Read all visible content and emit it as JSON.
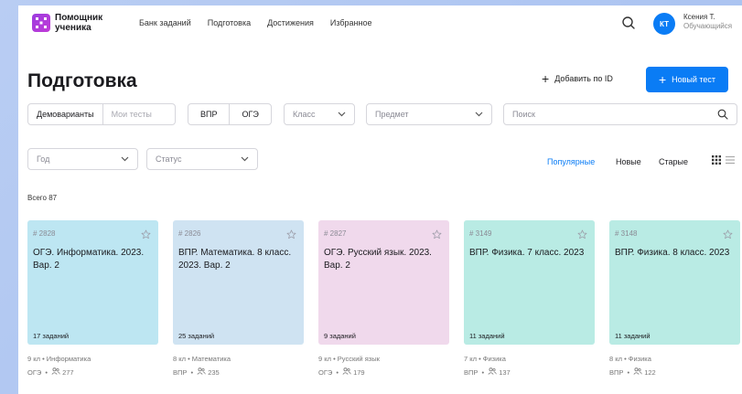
{
  "header": {
    "logo_line1": "Помощник",
    "logo_line2": "ученика",
    "nav": [
      "Банк заданий",
      "Подготовка",
      "Достижения",
      "Избранное"
    ],
    "avatar_initials": "КТ",
    "user_name": "Ксения Т.",
    "user_role": "Обучающийся"
  },
  "page": {
    "title": "Подготовка",
    "add_by_id": "Добавить по ID",
    "new_test": "Новый тест",
    "accent_color": "#0a7cf5"
  },
  "filters": {
    "source_tabs": [
      "Демоварианты",
      "Мои тесты"
    ],
    "exam_tabs": [
      "ВПР",
      "ОГЭ"
    ],
    "class_placeholder": "Класс",
    "subject_placeholder": "Предмет",
    "search_placeholder": "Поиск",
    "year_placeholder": "Год",
    "status_placeholder": "Статус"
  },
  "sort": {
    "options": [
      "Популярные",
      "Новые",
      "Старые"
    ],
    "active": "Популярные"
  },
  "total": "Всего 87",
  "cards": [
    {
      "id": "# 2828",
      "title": "ОГЭ. Информатика. 2023. Вар. 2",
      "count": "17 заданий",
      "meta1": "9 кл  •  Информатика",
      "exam": "ОГЭ",
      "views": "277",
      "color": "#bde6f2"
    },
    {
      "id": "# 2826",
      "title": "ВПР. Математика. 8 класс. 2023. Вар. 2",
      "count": "25 заданий",
      "meta1": "8 кл  •  Математика",
      "exam": "ВПР",
      "views": "235",
      "color": "#cfe3f2"
    },
    {
      "id": "# 2827",
      "title": "ОГЭ. Русский язык. 2023. Вар. 2",
      "count": "9 заданий",
      "meta1": "9 кл  •  Русский язык",
      "exam": "ОГЭ",
      "views": "179",
      "color": "#f0d9ec"
    },
    {
      "id": "# 3149",
      "title": "ВПР. Физика. 7 класс. 2023",
      "count": "11 заданий",
      "meta1": "7 кл  •  Физика",
      "exam": "ВПР",
      "views": "137",
      "color": "#b9ebe4"
    },
    {
      "id": "# 3148",
      "title": "ВПР. Физика. 8 класс. 2023",
      "count": "11 заданий",
      "meta1": "8 кл  •  Физика",
      "exam": "ВПР",
      "views": "122",
      "color": "#b9ebe4"
    }
  ]
}
